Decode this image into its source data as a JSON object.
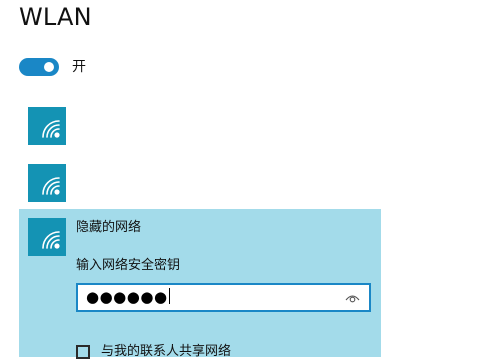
{
  "page": {
    "title": "WLAN"
  },
  "wifi_toggle": {
    "state_label": "开",
    "on": true
  },
  "networks": [
    {
      "icon": "wifi-signal-icon"
    },
    {
      "icon": "wifi-signal-icon"
    }
  ],
  "selected_network": {
    "icon": "wifi-signal-icon",
    "name": "隐藏的网络",
    "key_label": "输入网络安全密钥",
    "password_masked": "●●●●●●",
    "reveal_icon": "eye-icon",
    "share_label": "与我的联系人共享网络",
    "share_checked": false
  },
  "colors": {
    "accent": "#1a87c6",
    "tile": "#1493b4",
    "panel": "#a3dbea"
  }
}
